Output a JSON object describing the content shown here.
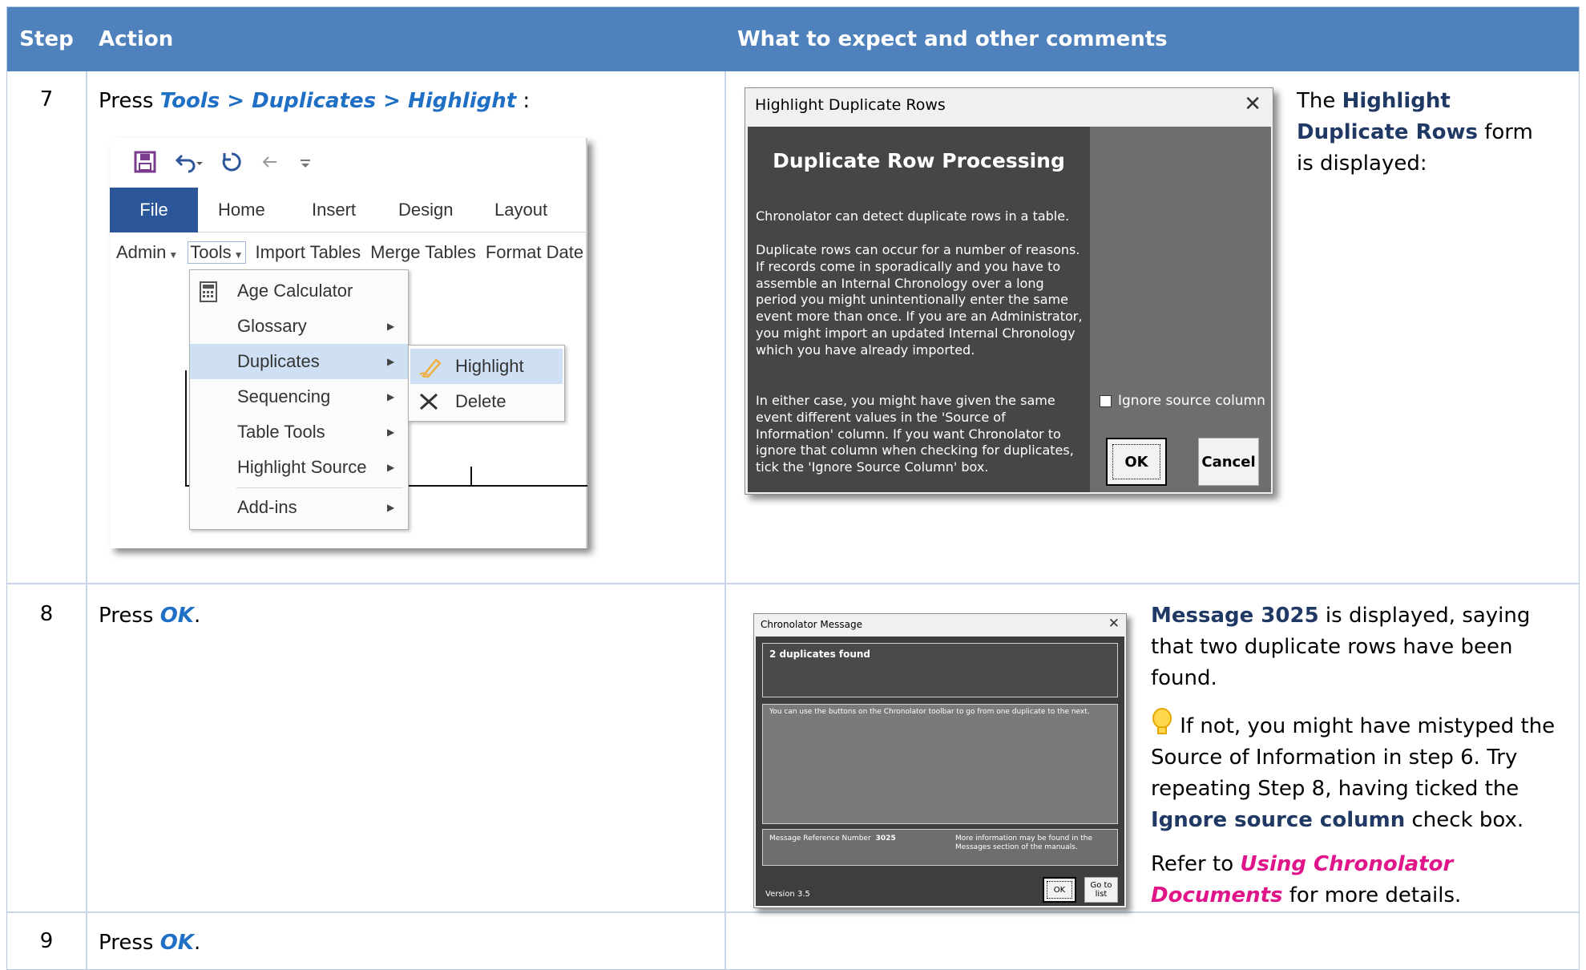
{
  "header": {
    "step": "Step",
    "action": "Action",
    "expect": "What to expect and other comments"
  },
  "rows": [
    {
      "step": "7",
      "action_prefix": "Press ",
      "action_emph": "Tools > Duplicates > Highlight",
      "action_suffix": " :",
      "comment_prefix": "The ",
      "comment_bold": "Highlight Duplicate Rows",
      "comment_suffix": " form is displayed:"
    },
    {
      "step": "8",
      "action_prefix": "Press ",
      "action_emph": "OK",
      "action_suffix": ".",
      "comment1_bold": "Message 3025",
      "comment1_rest": " is displayed, saying that two duplicate rows have been found.",
      "tip_text_a": " If not, you might have mistyped the Source of Information in step 6. Try repeating Step 8, having ticked the ",
      "tip_bold": "Ignore source column",
      "tip_text_b": " check box.",
      "refer_prefix": "Refer to ",
      "refer_link": "Using Chronolator Documents",
      "refer_suffix": " for more details."
    },
    {
      "step": "9",
      "action_prefix": "Press ",
      "action_emph": "OK",
      "action_suffix": "."
    }
  ],
  "ribbon": {
    "tabs": [
      "File",
      "Home",
      "Insert",
      "Design",
      "Layout"
    ],
    "commands": {
      "admin": "Admin",
      "tools": "Tools",
      "import": "Import Tables",
      "merge": "Merge Tables",
      "format": "Format Date"
    },
    "menu": [
      "Age Calculator",
      "Glossary",
      "Duplicates",
      "Sequencing",
      "Table Tools",
      "Highlight Source",
      "Add-ins"
    ],
    "submenu": [
      "Highlight",
      "Delete"
    ]
  },
  "dialog1": {
    "title": "Highlight Duplicate Rows",
    "heading": "Duplicate Row Processing",
    "p1": "Chronolator can detect duplicate rows in a table.",
    "p2": "Duplicate rows can occur for a number of reasons. If records come in sporadically and you have to assemble an Internal Chronology over a long period you might unintentionally enter the same event more than once. If you are an Administrator, you might import an updated Internal Chronology which you have already imported.",
    "p3": "In either case, you might have given the same event different values in the 'Source of Information' column. If you want Chronolator to ignore that column when checking for duplicates, tick the 'Ignore Source Column' box.",
    "checkbox": "Ignore source column",
    "ok": "OK",
    "cancel": "Cancel"
  },
  "dialog2": {
    "title": "Chronolator Message",
    "headline": "2 duplicates found",
    "body": "You can use the buttons on the Chronolator toolbar to go from one duplicate to the next.",
    "ref_label": "Message Reference Number",
    "ref_number": "3025",
    "more_info": "More information may be found in the Messages section of the manuals.",
    "version": "Version 3.5",
    "ok": "OK",
    "goto": "Go to list"
  },
  "colors": {
    "header": "#4f81bd",
    "emph_blue": "#1f6fc5",
    "link_pink": "#e0158a",
    "bold_navy": "#1f3864"
  }
}
